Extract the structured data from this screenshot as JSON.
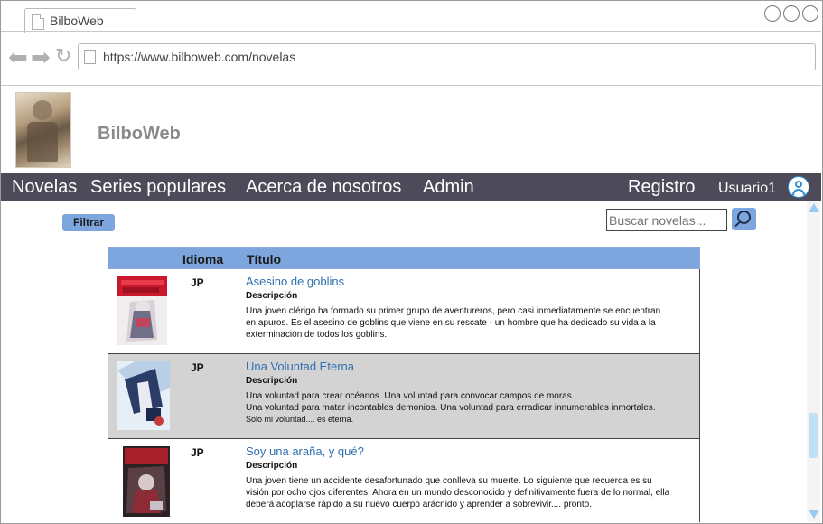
{
  "browser": {
    "tab_title": "BilboWeb",
    "url": "https://www.bilboweb.com/novelas"
  },
  "site": {
    "brand": "BilboWeb"
  },
  "nav": {
    "items": [
      "Novelas",
      "Series populares",
      "Acerca de nosotros",
      "Admin"
    ],
    "register": "Registro",
    "user": "Usuario1"
  },
  "toolbar": {
    "filter_label": "Filtrar",
    "search_placeholder": "Buscar novelas..."
  },
  "table": {
    "headers": [
      "Idioma",
      "Título"
    ],
    "rows": [
      {
        "lang": "JP",
        "title": "Asesino de goblins",
        "desc_label": "Descripción",
        "desc": [
          "Una joven clérigo ha formado su primer grupo de aventureros, pero casi inmediatamente se encuentran en apuros. Es el asesino de goblins que viene en su rescate - un hombre que ha dedicado su vida a la exterminación de todos los goblins."
        ]
      },
      {
        "lang": "JP",
        "title": "Una Voluntad Eterna",
        "desc_label": "Descripción",
        "desc": [
          "Una voluntad para crear océanos. Una voluntad para convocar campos de moras.",
          "Una voluntad para matar incontables demonios. Una voluntad para erradicar innumerables inmortales.",
          "Solo mi voluntad.... es eterna."
        ]
      },
      {
        "lang": "JP",
        "title": "Soy una araña, y qué?",
        "desc_label": "Descripción",
        "desc": [
          "Una joven tiene un accidente desafortunado que conlleva su muerte. Lo siguiente que recuerda es su visión por ocho ojos diferentes. Ahora en un mundo desconocido y definitivamente fuera de lo normal, ella deberá acoplarse rápido a su nuevo cuerpo arácnido y aprender a sobrevivir.... pronto."
        ]
      }
    ]
  },
  "colors": {
    "nav_bg": "#4d4b5a",
    "accent": "#7ea6de",
    "link": "#2e6fb0",
    "selected_row": "#d3d3d3"
  }
}
